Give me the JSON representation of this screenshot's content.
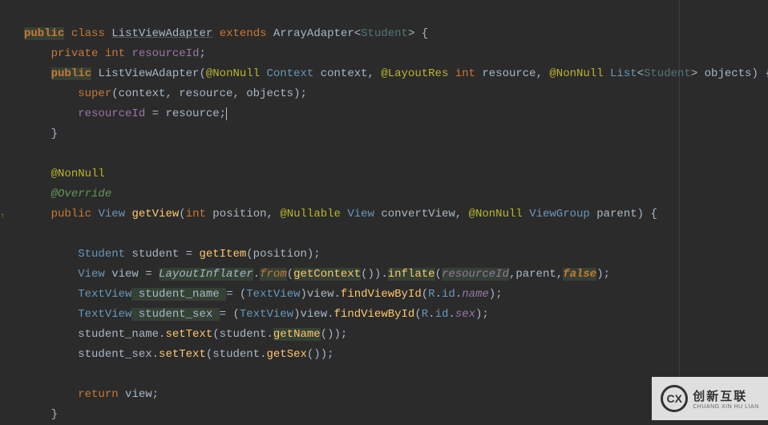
{
  "code": {
    "line1": {
      "kw_public": "public",
      "kw_class": "class",
      "class_name": "ListViewAdapter",
      "kw_extends": "extends",
      "super_class": "ArrayAdapter",
      "generic": "Student",
      "brace": " {"
    },
    "line2": {
      "kw_private": "private",
      "kw_int": "int",
      "field": "resourceId",
      "semi": ";"
    },
    "line3": {
      "kw_public": "public",
      "ctor": "ListViewAdapter",
      "lparen": "(",
      "ann1": "@NonNull",
      "type1": "Context",
      "p1": " context, ",
      "ann2": "@LayoutRes",
      "type2": "int",
      "p2": " resource, ",
      "ann3": "@NonNull",
      "type3": "List",
      "lt": "<",
      "gen": "Student",
      "gt": ">",
      "p3": " objects) {"
    },
    "line4": {
      "kw_super": "super",
      "args": "(context, resource, objects);"
    },
    "line5": {
      "field": "resourceId",
      "eq": " = resource;"
    },
    "line6": {
      "brace": "}"
    },
    "line8": {
      "ann": "@NonNull"
    },
    "line9": {
      "ann": "@Override"
    },
    "line10": {
      "kw_public": "public",
      "ret_type": "View",
      "method": "getView",
      "lparen": "(",
      "kw_int": "int",
      "p1": " position, ",
      "ann1": "@Nullable",
      "type1": "View",
      "p2": " convertView, ",
      "ann2": "@NonNull",
      "type2": "ViewGroup",
      "p3": " parent) {"
    },
    "line12": {
      "type": "Student",
      "var": " student = ",
      "call": "getItem",
      "args": "(position);"
    },
    "line13": {
      "type": "View",
      "var": " view = ",
      "cls": "LayoutInflater",
      "dot1": ".",
      "from": "from",
      "lp": "(",
      "getctx": "getContext",
      "rp": "()).",
      "inflate": "inflate",
      "lp2": "(",
      "resid": "resourceId",
      "comma": ",parent,",
      "false": "false",
      "end": ");"
    },
    "line14": {
      "type": "TextView",
      "var": " student_name ",
      "eq": "= (",
      "cast": "TextView",
      "mid": ")view.",
      "find": "findViewById",
      "lp": "(",
      "r": "R",
      "dot": ".",
      "id": "id",
      "dot2": ".",
      "name": "name",
      "end": ");"
    },
    "line15": {
      "type": "TextView",
      "var": " student_sex ",
      "eq": "= (",
      "cast": "TextView",
      "mid": ")view.",
      "find": "findViewById",
      "lp": "(",
      "r": "R",
      "dot": ".",
      "id": "id",
      "dot2": ".",
      "sex": "sex",
      "end": ");"
    },
    "line16": {
      "pre": "student_name.",
      "set": "setText",
      "lp": "(student.",
      "get": "getName",
      "end": "());"
    },
    "line17": {
      "pre": "student_sex.",
      "set": "setText",
      "lp": "(student.",
      "get": "getSex",
      "end": "());"
    },
    "line19": {
      "kw_return": "return",
      "val": " view;"
    },
    "line20": {
      "brace": "}"
    }
  },
  "watermark": {
    "logo": "CX",
    "cn": "创新互联",
    "en": "CHUANG XIN HU LIAN"
  }
}
